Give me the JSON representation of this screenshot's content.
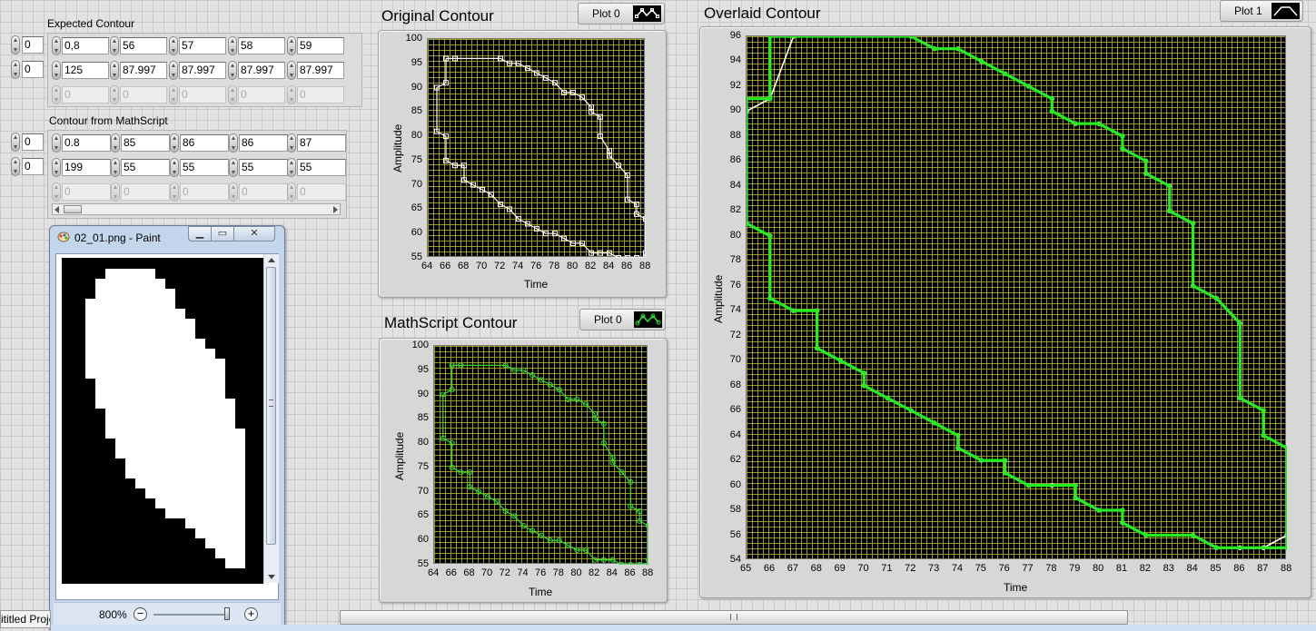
{
  "expected_contour": {
    "label": "Expected Contour",
    "index_row": "0",
    "index_col": "0",
    "rows": [
      [
        "0,8",
        "56",
        "57",
        "58",
        "59"
      ],
      [
        "125",
        "87.997",
        "87.997",
        "87.997",
        "87.997"
      ],
      [
        "0",
        "0",
        "0",
        "0",
        "0"
      ]
    ]
  },
  "mathscript_contour": {
    "label": "Contour from MathScript",
    "index_row": "0",
    "index_col": "0",
    "rows": [
      [
        "0.8",
        "85",
        "86",
        "86",
        "87"
      ],
      [
        "199",
        "55",
        "55",
        "55",
        "55"
      ],
      [
        "0",
        "0",
        "0",
        "0",
        "0"
      ]
    ]
  },
  "graph_original": {
    "title": "Original Contour",
    "legend": "Plot 0",
    "xlabel": "Time",
    "ylabel": "Amplitude",
    "x_ticks": [
      "64",
      "66",
      "68",
      "70",
      "72",
      "74",
      "76",
      "78",
      "80",
      "82",
      "84",
      "86",
      "88"
    ],
    "y_ticks": [
      "100",
      "95",
      "90",
      "85",
      "80",
      "75",
      "70",
      "65",
      "60",
      "55"
    ]
  },
  "graph_mathscript": {
    "title": "MathScript Contour",
    "legend": "Plot 0",
    "xlabel": "Time",
    "ylabel": "Amplitude",
    "x_ticks": [
      "64",
      "66",
      "68",
      "70",
      "72",
      "74",
      "76",
      "78",
      "80",
      "82",
      "84",
      "86",
      "88"
    ],
    "y_ticks": [
      "100",
      "95",
      "90",
      "85",
      "80",
      "75",
      "70",
      "65",
      "60",
      "55"
    ]
  },
  "graph_overlaid": {
    "title": "Overlaid Contour",
    "legend": "Plot 1",
    "xlabel": "Time",
    "ylabel": "Amplitude",
    "x_ticks": [
      "65",
      "66",
      "67",
      "68",
      "69",
      "70",
      "71",
      "72",
      "73",
      "74",
      "75",
      "76",
      "77",
      "78",
      "79",
      "80",
      "81",
      "82",
      "83",
      "84",
      "85",
      "86",
      "87",
      "88"
    ],
    "y_ticks": [
      "96",
      "94",
      "92",
      "90",
      "88",
      "86",
      "84",
      "82",
      "80",
      "78",
      "76",
      "74",
      "72",
      "70",
      "68",
      "66",
      "64",
      "62",
      "60",
      "58",
      "56",
      "54"
    ]
  },
  "chart_data": [
    {
      "type": "line",
      "title": "Original Contour",
      "xlabel": "Time",
      "ylabel": "Amplitude",
      "xlim": [
        64,
        88
      ],
      "ylim": [
        55,
        100
      ],
      "series": [
        {
          "name": "Plot 0",
          "color": "#ffffff",
          "marker": "square",
          "points": [
            [
              66,
              96
            ],
            [
              67,
              96
            ],
            [
              72,
              96
            ],
            [
              73,
              95
            ],
            [
              74,
              95
            ],
            [
              75,
              94
            ],
            [
              76,
              93
            ],
            [
              77,
              92
            ],
            [
              78,
              91
            ],
            [
              79,
              89
            ],
            [
              80,
              89
            ],
            [
              81,
              88
            ],
            [
              82,
              86
            ],
            [
              82,
              85
            ],
            [
              83,
              84
            ],
            [
              83,
              80
            ],
            [
              84,
              77
            ],
            [
              84,
              76
            ],
            [
              85,
              74
            ],
            [
              86,
              72
            ],
            [
              86,
              67
            ],
            [
              87,
              66
            ],
            [
              87,
              64
            ],
            [
              88,
              63
            ],
            [
              88,
              56
            ],
            [
              88,
              55
            ],
            [
              87,
              55
            ],
            [
              86,
              55
            ],
            [
              85,
              55
            ],
            [
              84,
              56
            ],
            [
              83,
              56
            ],
            [
              82,
              56
            ],
            [
              81,
              58
            ],
            [
              80,
              58
            ],
            [
              79,
              59
            ],
            [
              78,
              60
            ],
            [
              77,
              60
            ],
            [
              76,
              61
            ],
            [
              75,
              62
            ],
            [
              74,
              63
            ],
            [
              73,
              65
            ],
            [
              72,
              66
            ],
            [
              71,
              68
            ],
            [
              70,
              69
            ],
            [
              69,
              70
            ],
            [
              68,
              71
            ],
            [
              68,
              74
            ],
            [
              67,
              74
            ],
            [
              66,
              75
            ],
            [
              66,
              80
            ],
            [
              65,
              81
            ],
            [
              65,
              90
            ],
            [
              66,
              91
            ],
            [
              66,
              96
            ]
          ]
        }
      ]
    },
    {
      "type": "line",
      "title": "MathScript Contour",
      "xlabel": "Time",
      "ylabel": "Amplitude",
      "xlim": [
        64,
        88
      ],
      "ylim": [
        55,
        100
      ],
      "series": [
        {
          "name": "Plot 0",
          "color": "#33dd33",
          "marker": "diamond",
          "points": [
            [
              66,
              96
            ],
            [
              67,
              96
            ],
            [
              72,
              96
            ],
            [
              73,
              95
            ],
            [
              74,
              95
            ],
            [
              75,
              94
            ],
            [
              76,
              93
            ],
            [
              77,
              92
            ],
            [
              78,
              91
            ],
            [
              79,
              89
            ],
            [
              80,
              89
            ],
            [
              81,
              88
            ],
            [
              82,
              86
            ],
            [
              82,
              85
            ],
            [
              83,
              84
            ],
            [
              83,
              80
            ],
            [
              84,
              77
            ],
            [
              84,
              76
            ],
            [
              85,
              74
            ],
            [
              86,
              72
            ],
            [
              86,
              67
            ],
            [
              87,
              66
            ],
            [
              87,
              64
            ],
            [
              88,
              63
            ],
            [
              88,
              56
            ],
            [
              88,
              55
            ],
            [
              87,
              55
            ],
            [
              86,
              55
            ],
            [
              85,
              55
            ],
            [
              84,
              56
            ],
            [
              83,
              56
            ],
            [
              82,
              56
            ],
            [
              81,
              58
            ],
            [
              80,
              58
            ],
            [
              79,
              59
            ],
            [
              78,
              60
            ],
            [
              77,
              60
            ],
            [
              76,
              61
            ],
            [
              75,
              62
            ],
            [
              74,
              63
            ],
            [
              73,
              65
            ],
            [
              72,
              66
            ],
            [
              71,
              68
            ],
            [
              70,
              69
            ],
            [
              69,
              70
            ],
            [
              68,
              71
            ],
            [
              68,
              74
            ],
            [
              67,
              74
            ],
            [
              66,
              75
            ],
            [
              66,
              80
            ],
            [
              65,
              81
            ],
            [
              65,
              90
            ],
            [
              66,
              91
            ],
            [
              66,
              96
            ]
          ]
        }
      ]
    },
    {
      "type": "line",
      "title": "Overlaid Contour",
      "xlabel": "Time",
      "ylabel": "Amplitude",
      "xlim": [
        65,
        88
      ],
      "ylim": [
        54,
        96
      ],
      "series": [
        {
          "name": "Plot 0",
          "color": "#ffffff",
          "points": [
            [
              65,
              90
            ],
            [
              66,
              91
            ],
            [
              67,
              96
            ],
            [
              72,
              96
            ],
            [
              73,
              95
            ],
            [
              74,
              95
            ],
            [
              75,
              94
            ],
            [
              76,
              93
            ],
            [
              77,
              92
            ],
            [
              78,
              91
            ],
            [
              78,
              90
            ],
            [
              79,
              89
            ],
            [
              80,
              89
            ],
            [
              81,
              88
            ],
            [
              81,
              87
            ],
            [
              82,
              86
            ],
            [
              82,
              85
            ],
            [
              83,
              84
            ],
            [
              83,
              82
            ],
            [
              84,
              81
            ],
            [
              84,
              76
            ],
            [
              85,
              75
            ],
            [
              86,
              73
            ],
            [
              86,
              67
            ],
            [
              87,
              66
            ],
            [
              87,
              64
            ],
            [
              88,
              63
            ],
            [
              88,
              56
            ],
            [
              87,
              55
            ],
            [
              86,
              55
            ],
            [
              85,
              55
            ],
            [
              84,
              56
            ],
            [
              82,
              56
            ],
            [
              81,
              57
            ],
            [
              81,
              58
            ],
            [
              80,
              58
            ],
            [
              79,
              59
            ],
            [
              79,
              60
            ],
            [
              78,
              60
            ],
            [
              77,
              60
            ],
            [
              76,
              61
            ],
            [
              76,
              62
            ],
            [
              75,
              62
            ],
            [
              74,
              63
            ],
            [
              74,
              64
            ],
            [
              73,
              65
            ],
            [
              72,
              66
            ],
            [
              71,
              67
            ],
            [
              70,
              68
            ],
            [
              70,
              69
            ],
            [
              69,
              70
            ],
            [
              68,
              71
            ],
            [
              68,
              74
            ],
            [
              67,
              74
            ],
            [
              66,
              75
            ],
            [
              66,
              80
            ],
            [
              65,
              81
            ],
            [
              65,
              90
            ]
          ]
        },
        {
          "name": "Plot 1",
          "color": "#22ee22",
          "points": [
            [
              66,
              96
            ],
            [
              72,
              96
            ],
            [
              73,
              95
            ],
            [
              74,
              95
            ],
            [
              75,
              94
            ],
            [
              76,
              93
            ],
            [
              77,
              92
            ],
            [
              78,
              91
            ],
            [
              78,
              90
            ],
            [
              79,
              89
            ],
            [
              80,
              89
            ],
            [
              81,
              88
            ],
            [
              81,
              87
            ],
            [
              82,
              86
            ],
            [
              82,
              85
            ],
            [
              83,
              84
            ],
            [
              83,
              82
            ],
            [
              84,
              81
            ],
            [
              84,
              76
            ],
            [
              85,
              75
            ],
            [
              86,
              73
            ],
            [
              86,
              67
            ],
            [
              87,
              66
            ],
            [
              87,
              64
            ],
            [
              88,
              63
            ],
            [
              88,
              55
            ],
            [
              85,
              55
            ],
            [
              84,
              56
            ],
            [
              82,
              56
            ],
            [
              81,
              57
            ],
            [
              81,
              58
            ],
            [
              80,
              58
            ],
            [
              79,
              59
            ],
            [
              79,
              60
            ],
            [
              77,
              60
            ],
            [
              76,
              61
            ],
            [
              76,
              62
            ],
            [
              75,
              62
            ],
            [
              74,
              63
            ],
            [
              74,
              64
            ],
            [
              73,
              65
            ],
            [
              72,
              66
            ],
            [
              71,
              67
            ],
            [
              70,
              68
            ],
            [
              70,
              69
            ],
            [
              69,
              70
            ],
            [
              68,
              71
            ],
            [
              68,
              74
            ],
            [
              67,
              74
            ],
            [
              66,
              75
            ],
            [
              66,
              80
            ],
            [
              65,
              81
            ],
            [
              65,
              91
            ],
            [
              66,
              91
            ],
            [
              66,
              96
            ]
          ]
        }
      ]
    }
  ],
  "paint_window": {
    "title": "02_01.png - Paint",
    "zoom_label": "800%",
    "btn_min": "▁",
    "btn_max": "▭",
    "btn_close": "✕"
  },
  "taskbar": {
    "project_label": "ititled Proje"
  }
}
